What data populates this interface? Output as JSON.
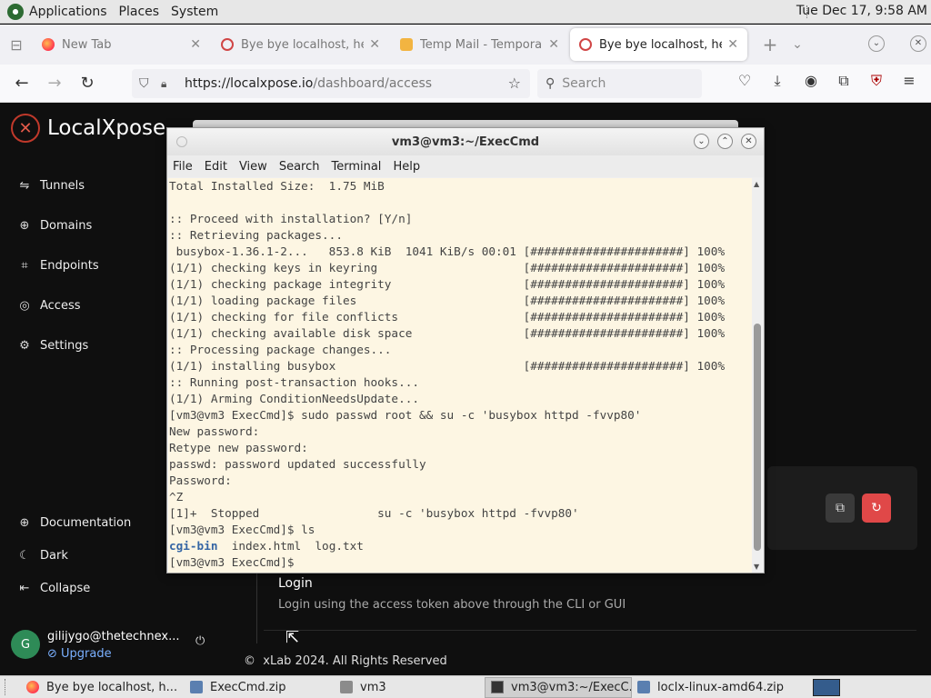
{
  "top_panel": {
    "menus": [
      "Applications",
      "Places",
      "System"
    ],
    "clock": "Tue Dec 17,  9:58 AM"
  },
  "browser": {
    "tabs": [
      {
        "label": "New Tab",
        "icon": "firefox-icon",
        "active": false
      },
      {
        "label": "Bye bye localhost, hell",
        "icon": "localxpose-icon",
        "active": false
      },
      {
        "label": "Temp Mail - Temporar",
        "icon": "tempmail-icon",
        "active": false
      },
      {
        "label": "Bye bye localhost, hell",
        "icon": "localxpose-icon",
        "active": true
      }
    ],
    "url_host": "https://localxpose.io",
    "url_path": "/dashboard/access",
    "search_placeholder": "Search"
  },
  "app": {
    "brand": "LocalXpose",
    "nav_items": [
      {
        "label": "Tunnels",
        "icon": "tunnels-icon"
      },
      {
        "label": "Domains",
        "icon": "globe-icon"
      },
      {
        "label": "Endpoints",
        "icon": "endpoints-icon"
      },
      {
        "label": "Access",
        "icon": "fingerprint-icon"
      },
      {
        "label": "Settings",
        "icon": "gear-icon"
      }
    ],
    "bottom_nav": [
      {
        "label": "Documentation",
        "icon": "globe-icon"
      },
      {
        "label": "Dark",
        "icon": "moon-icon"
      },
      {
        "label": "Collapse",
        "icon": "collapse-icon"
      }
    ],
    "user": {
      "initial": "G",
      "email": "gilijygo@thetechnex...",
      "upgrade": "Upgrade"
    },
    "login_title": "Login",
    "login_desc": "Login using the access token above through the CLI or GUI",
    "footer": "xLab  2024. All Rights Reserved"
  },
  "terminal": {
    "title": "vm3@vm3:~/ExecCmd",
    "menus": [
      "File",
      "Edit",
      "View",
      "Search",
      "Terminal",
      "Help"
    ],
    "lines": [
      "Total Installed Size:  1.75 MiB",
      "",
      ":: Proceed with installation? [Y/n]",
      ":: Retrieving packages...",
      " busybox-1.36.1-2...   853.8 KiB  1041 KiB/s 00:01 [######################] 100%",
      "(1/1) checking keys in keyring                     [######################] 100%",
      "(1/1) checking package integrity                   [######################] 100%",
      "(1/1) loading package files                        [######################] 100%",
      "(1/1) checking for file conflicts                  [######################] 100%",
      "(1/1) checking available disk space                [######################] 100%",
      ":: Processing package changes...",
      "(1/1) installing busybox                           [######################] 100%",
      ":: Running post-transaction hooks...",
      "(1/1) Arming ConditionNeedsUpdate...",
      "[vm3@vm3 ExecCmd]$ sudo passwd root && su -c 'busybox httpd -fvvp80'",
      "New password:",
      "Retype new password:",
      "passwd: password updated successfully",
      "Password:",
      "^Z",
      "[1]+  Stopped                 su -c 'busybox httpd -fvvp80'",
      "[vm3@vm3 ExecCmd]$ ls"
    ],
    "ls_dir": "cgi-bin",
    "ls_files": "  index.html  log.txt",
    "prompt": "[vm3@vm3 ExecCmd]$"
  },
  "taskbar": {
    "items": [
      {
        "label": "Bye bye localhost, h...",
        "icon": "firefox-icon"
      },
      {
        "label": "ExecCmd.zip",
        "icon": "archive-icon"
      },
      {
        "label": "vm3",
        "icon": "folder-icon"
      },
      {
        "label": "vm3@vm3:~/ExecC...",
        "icon": "terminal-icon"
      },
      {
        "label": "loclx-linux-amd64.zip",
        "icon": "archive-icon"
      }
    ]
  }
}
